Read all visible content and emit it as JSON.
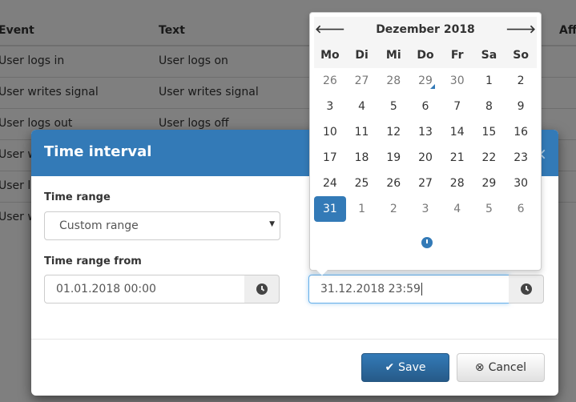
{
  "table": {
    "headers": [
      "Event",
      "Text",
      "Aff"
    ],
    "rows": [
      [
        "User logs in",
        "User logs on"
      ],
      [
        "User writes signal",
        "User writes signal"
      ],
      [
        "User logs out",
        "User logs off"
      ],
      [
        "User w",
        ""
      ],
      [
        "User lo",
        ""
      ],
      [
        "User w",
        ""
      ]
    ]
  },
  "modal": {
    "title": "Time interval",
    "close": "×",
    "time_range_label": "Time range",
    "time_range_value": "Custom range",
    "from_label": "Time range from",
    "from_value": "01.01.2018 00:00",
    "to_value": "31.12.2018 23:59",
    "save": "Save",
    "cancel": "Cancel"
  },
  "calendar": {
    "month": "Dezember 2018",
    "prev": "🡐",
    "next": "🡒",
    "weekdays": [
      "Mo",
      "Di",
      "Mi",
      "Do",
      "Fr",
      "Sa",
      "So"
    ],
    "days": [
      "26",
      "27",
      "28",
      "29",
      "30",
      "1",
      "2",
      "3",
      "4",
      "5",
      "6",
      "7",
      "8",
      "9",
      "10",
      "11",
      "12",
      "13",
      "14",
      "15",
      "16",
      "17",
      "18",
      "19",
      "20",
      "21",
      "22",
      "23",
      "24",
      "25",
      "26",
      "27",
      "28",
      "29",
      "30",
      "31",
      "1",
      "2",
      "3",
      "4",
      "5",
      "6"
    ],
    "selected": "31",
    "today": "29"
  },
  "colors": {
    "primary": "#337ab7"
  }
}
